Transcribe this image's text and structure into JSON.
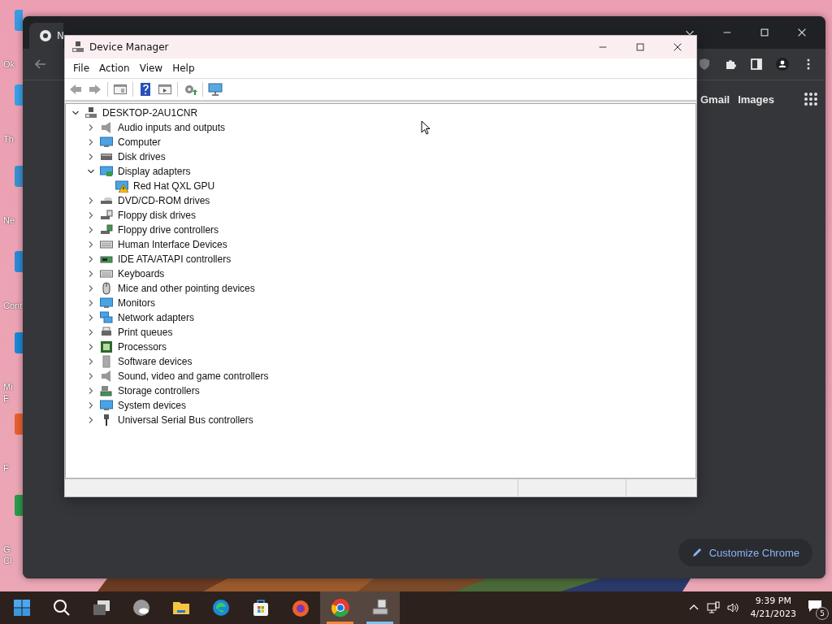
{
  "desktop_icons": [
    {
      "lines": [
        "Ok"
      ]
    },
    {
      "lines": [
        "Th"
      ]
    },
    {
      "lines": [
        "Ne"
      ]
    },
    {
      "lines": [
        "Cont"
      ]
    },
    {
      "lines": [
        "Mi",
        "E"
      ]
    },
    {
      "lines": [
        "F"
      ]
    },
    {
      "lines": [
        "G",
        "Cl"
      ]
    }
  ],
  "browser": {
    "tab_title": "N",
    "links": [
      "Gmail",
      "Images"
    ],
    "customize_button": "Customize Chrome"
  },
  "device_manager": {
    "title": "Device Manager",
    "menu": [
      "File",
      "Action",
      "View",
      "Help"
    ],
    "tree": {
      "label": "DESKTOP-2AU1CNR",
      "expanded": true,
      "children": [
        {
          "label": "Audio inputs and outputs",
          "expanded": false
        },
        {
          "label": "Computer",
          "expanded": false
        },
        {
          "label": "Disk drives",
          "expanded": false
        },
        {
          "label": "Display adapters",
          "expanded": true,
          "children": [
            {
              "label": "Red Hat QXL GPU",
              "warning": true
            }
          ]
        },
        {
          "label": "DVD/CD-ROM drives",
          "expanded": false
        },
        {
          "label": "Floppy disk drives",
          "expanded": false
        },
        {
          "label": "Floppy drive controllers",
          "expanded": false
        },
        {
          "label": "Human Interface Devices",
          "expanded": false
        },
        {
          "label": "IDE ATA/ATAPI controllers",
          "expanded": false
        },
        {
          "label": "Keyboards",
          "expanded": false
        },
        {
          "label": "Mice and other pointing devices",
          "expanded": false
        },
        {
          "label": "Monitors",
          "expanded": false
        },
        {
          "label": "Network adapters",
          "expanded": false
        },
        {
          "label": "Print queues",
          "expanded": false
        },
        {
          "label": "Processors",
          "expanded": false
        },
        {
          "label": "Software devices",
          "expanded": false
        },
        {
          "label": "Sound, video and game controllers",
          "expanded": false
        },
        {
          "label": "Storage controllers",
          "expanded": false
        },
        {
          "label": "System devices",
          "expanded": false
        },
        {
          "label": "Universal Serial Bus controllers",
          "expanded": false
        }
      ]
    }
  },
  "taskbar": {
    "apps": [
      {
        "open": false
      },
      {
        "open": false
      },
      {
        "open": false
      },
      {
        "open": false
      },
      {
        "open": false
      },
      {
        "open": false
      },
      {
        "open": false
      },
      {
        "open": false
      },
      {
        "open": true
      },
      {
        "open": true
      }
    ],
    "tray": {
      "time": "9:39 PM",
      "date": "4/21/2023",
      "notifications": "5"
    }
  }
}
